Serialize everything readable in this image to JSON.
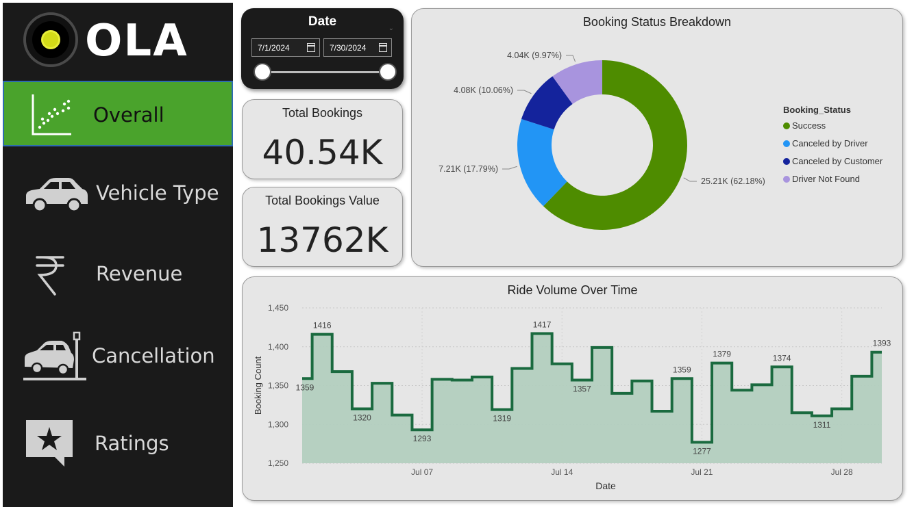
{
  "brand": {
    "name": "OLA"
  },
  "nav": {
    "items": [
      {
        "label": "Overall",
        "icon": "scatter-chart-icon",
        "active": true
      },
      {
        "label": "Vehicle Type",
        "icon": "car-icon",
        "active": false
      },
      {
        "label": "Revenue",
        "icon": "rupee-icon",
        "active": false
      },
      {
        "label": "Cancellation",
        "icon": "car-crash-icon",
        "active": false
      },
      {
        "label": "Ratings",
        "icon": "star-message-icon",
        "active": false
      }
    ]
  },
  "date_filter": {
    "title": "Date",
    "start": "7/1/2024",
    "end": "7/30/2024"
  },
  "kpis": {
    "total_bookings": {
      "label": "Total Bookings",
      "value": "40.54K"
    },
    "total_bookings_value": {
      "label": "Total Bookings Value",
      "value": "13762K"
    }
  },
  "colors": {
    "success": "#4e8c00",
    "canceled_driver": "#2295f5",
    "canceled_customer": "#14239c",
    "driver_not_found": "#a894de",
    "line": "#1a6a3f",
    "area": "#b3cfbf"
  },
  "chart_data": [
    {
      "type": "pie",
      "title": "Booking Status Breakdown",
      "legend_title": "Booking_Status",
      "legend_position": "right",
      "donut": true,
      "categories": [
        "Success",
        "Canceled by Driver",
        "Canceled by Customer",
        "Driver Not Found"
      ],
      "values": [
        25.21,
        7.21,
        4.08,
        4.04
      ],
      "percents": [
        62.18,
        17.79,
        10.06,
        9.97
      ],
      "data_labels": [
        "25.21K (62.18%)",
        "7.21K (17.79%)",
        "4.08K (10.06%)",
        "4.04K (9.97%)"
      ]
    },
    {
      "type": "area",
      "title": "Ride Volume Over Time",
      "xlabel": "Date",
      "ylabel": "Booking Count",
      "ylim": [
        1250,
        1450
      ],
      "yticks": [
        "1,250",
        "1,300",
        "1,350",
        "1,400",
        "1,450"
      ],
      "xticks": [
        "Jul 07",
        "Jul 14",
        "Jul 21",
        "Jul 28"
      ],
      "x": [
        1,
        2,
        3,
        4,
        5,
        6,
        7,
        8,
        9,
        10,
        11,
        12,
        13,
        14,
        15,
        16,
        17,
        18,
        19,
        20,
        21,
        22,
        23,
        24,
        25,
        26,
        27,
        28,
        29,
        30
      ],
      "values": [
        1359,
        1416,
        1368,
        1320,
        1353,
        1312,
        1293,
        1358,
        1357,
        1361,
        1319,
        1372,
        1417,
        1378,
        1357,
        1399,
        1340,
        1356,
        1317,
        1359,
        1277,
        1379,
        1344,
        1351,
        1374,
        1315,
        1311,
        1320,
        1362,
        1393
      ],
      "labeled_points": [
        {
          "day": 1,
          "label": "1359"
        },
        {
          "day": 2,
          "label": "1416"
        },
        {
          "day": 4,
          "label": "1320"
        },
        {
          "day": 7,
          "label": "1293"
        },
        {
          "day": 11,
          "label": "1319"
        },
        {
          "day": 13,
          "label": "1417"
        },
        {
          "day": 15,
          "label": "1357"
        },
        {
          "day": 20,
          "label": "1359"
        },
        {
          "day": 21,
          "label": "1277"
        },
        {
          "day": 22,
          "label": "1379"
        },
        {
          "day": 25,
          "label": "1374"
        },
        {
          "day": 27,
          "label": "1311"
        },
        {
          "day": 30,
          "label": "1393"
        }
      ]
    }
  ]
}
